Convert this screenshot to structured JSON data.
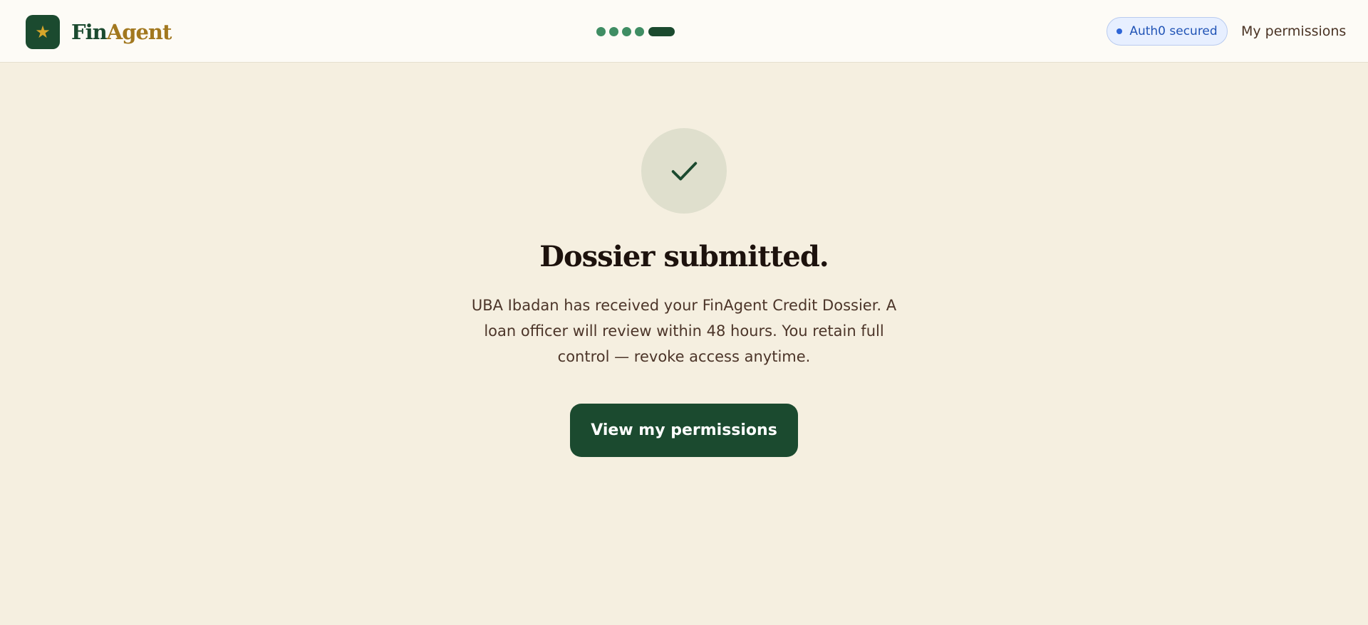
{
  "brand": {
    "icon": "star-icon",
    "name_primary": "Fin",
    "name_accent": "Agent",
    "colors": {
      "dark_green": "#1b4a2f",
      "gold": "#a2781f",
      "page_background": "#f5efe0"
    }
  },
  "header": {
    "progress": {
      "completed_steps": 4,
      "current_step": 5,
      "total_steps": 5
    },
    "security_badge": {
      "label": "Auth0 secured",
      "color": "#2154b6"
    },
    "permissions_link": "My permissions"
  },
  "main": {
    "status_icon": "check-icon",
    "title": "Dossier submitted.",
    "message": "UBA Ibadan has received your FinAgent Credit Dossier. A loan officer will review within 48 hours. You retain full control — revoke access anytime.",
    "primary_button": "View my permissions"
  }
}
